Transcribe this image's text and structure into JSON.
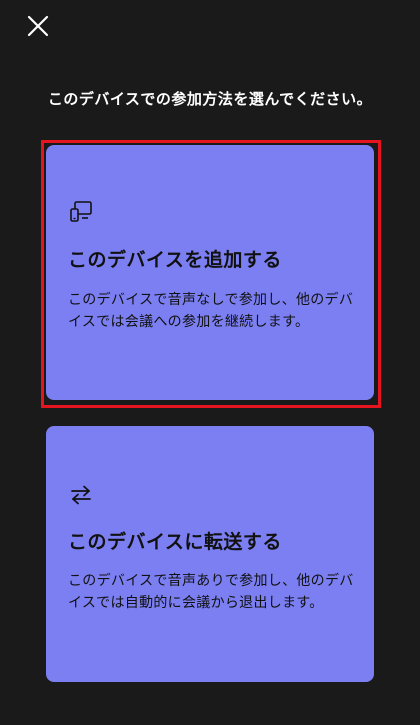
{
  "header": {
    "close_icon": "close-icon"
  },
  "prompt": "このデバイスでの参加方法を選んでください。",
  "options": [
    {
      "icon": "devices-icon",
      "title": "このデバイスを追加する",
      "description": "このデバイスで音声なしで参加し、他のデバイスでは会議への参加を継続します。",
      "selected": true
    },
    {
      "icon": "transfer-arrows-icon",
      "title": "このデバイスに転送する",
      "description": "このデバイスで音声ありで参加し、他のデバイスでは自動的に会議から退出します。",
      "selected": false
    }
  ],
  "colors": {
    "background": "#1b1a1a",
    "card": "#7b7ff2",
    "selection_border": "#e5141e",
    "text_on_card": "#111111"
  }
}
